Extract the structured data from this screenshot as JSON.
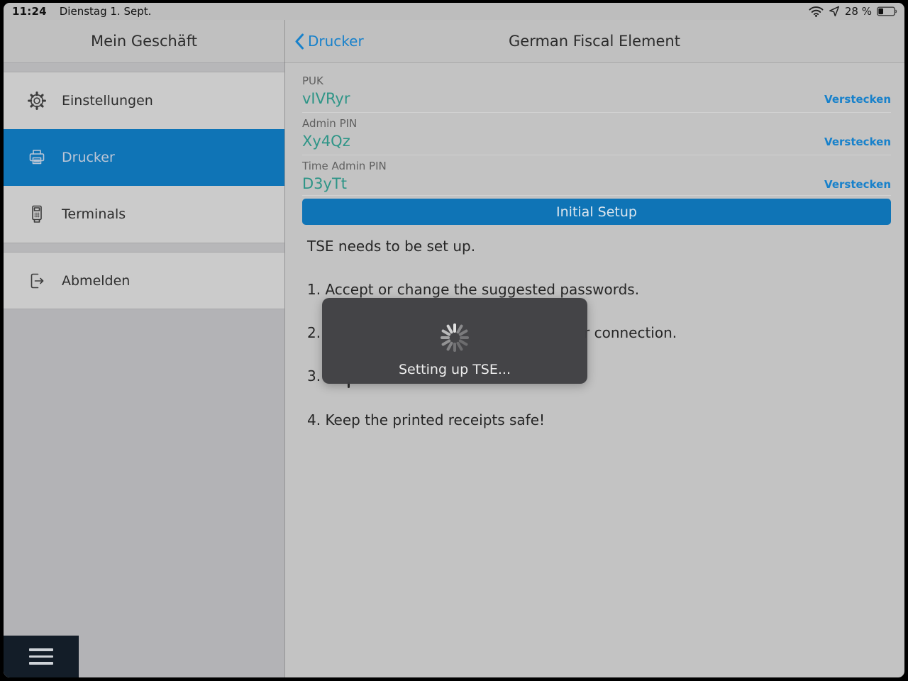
{
  "status_bar": {
    "time": "11:24",
    "date": "Dienstag 1. Sept.",
    "battery_percent": "28 %",
    "icons": [
      "wifi-icon",
      "location-icon",
      "battery-icon"
    ]
  },
  "sidebar": {
    "title": "Mein Geschäft",
    "items": [
      {
        "label": "Einstellungen",
        "icon": "gear-icon",
        "selected": false
      },
      {
        "label": "Drucker",
        "icon": "printer-icon",
        "selected": true
      },
      {
        "label": "Terminals",
        "icon": "card-terminal-icon",
        "selected": false
      },
      {
        "label": "Abmelden",
        "icon": "logout-icon",
        "selected": false
      }
    ],
    "menu_icon": "hamburger-menu-icon"
  },
  "nav": {
    "back_label": "Drucker",
    "title": "German Fiscal Element"
  },
  "fields": [
    {
      "label": "PUK",
      "value": "vIVRyr",
      "action_label": "Verstecken"
    },
    {
      "label": "Admin PIN",
      "value": "Xy4Qz",
      "action_label": "Verstecken"
    },
    {
      "label": "Time Admin PIN",
      "value": "D3yTt",
      "action_label": "Verstecken"
    }
  ],
  "primary_button": {
    "label": "Initial Setup"
  },
  "instructions": {
    "intro": "TSE needs to be set up.",
    "steps": [
      {
        "prefix": "1. Accept or change the suggested passwords.",
        "suffix": ""
      },
      {
        "prefix": "2.",
        "suffix": "r connection."
      },
      {
        "prefix": "3.",
        "suffix": ""
      },
      {
        "prefix": "4. Keep the printed receipts safe!",
        "suffix": ""
      }
    ]
  },
  "modal": {
    "message": "Setting up TSE...",
    "spinner": "activity-spinner-icon"
  },
  "colors": {
    "accent_blue": "#0f74b6",
    "link_blue": "#1781cb",
    "value_teal": "#2e9587",
    "modal_bg": "#404043",
    "hamburger_bg": "#131d28"
  }
}
